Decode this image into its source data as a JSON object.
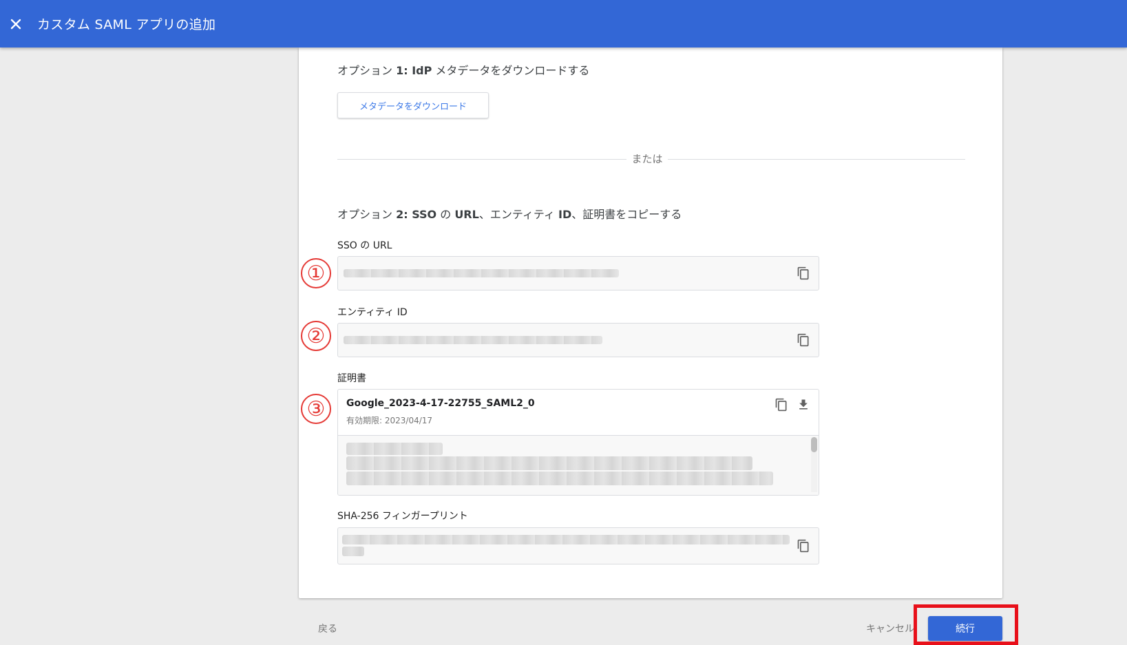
{
  "header": {
    "title": "カスタム SAML アプリの追加"
  },
  "option1": {
    "title_prefix": "オプション ",
    "title_bold": "1: IdP",
    "title_suffix": " メタデータをダウンロードする",
    "download_button": "メタデータをダウンロード"
  },
  "divider_text": "または",
  "option2": {
    "title_prefix": "オプション ",
    "title_bold1": "2: SSO",
    "title_mid": " の ",
    "title_bold2": "URL",
    "title_mid2": "、エンティティ ",
    "title_bold3": "ID",
    "title_suffix": "、証明書をコピーする"
  },
  "fields": {
    "sso_url_label": "SSO の URL",
    "entity_id_label": "エンティティ ID",
    "cert_label": "証明書",
    "fingerprint_label": "SHA-256 フィンガープリント"
  },
  "certificate": {
    "name": "Google_2023-4-17-22755_SAML2_0",
    "expiry": "有効期限: 2023/04/17"
  },
  "annotations": [
    "①",
    "②",
    "③"
  ],
  "footer": {
    "back": "戻る",
    "cancel": "キャンセル",
    "continue": "続行"
  },
  "colors": {
    "header_bg": "#3367d6",
    "accent_link": "#3b78e7",
    "annotation_red": "#e53935",
    "highlight_red": "#e8101a"
  },
  "icons": {
    "close": "close-icon",
    "copy": "copy-icon",
    "download": "download-icon"
  }
}
